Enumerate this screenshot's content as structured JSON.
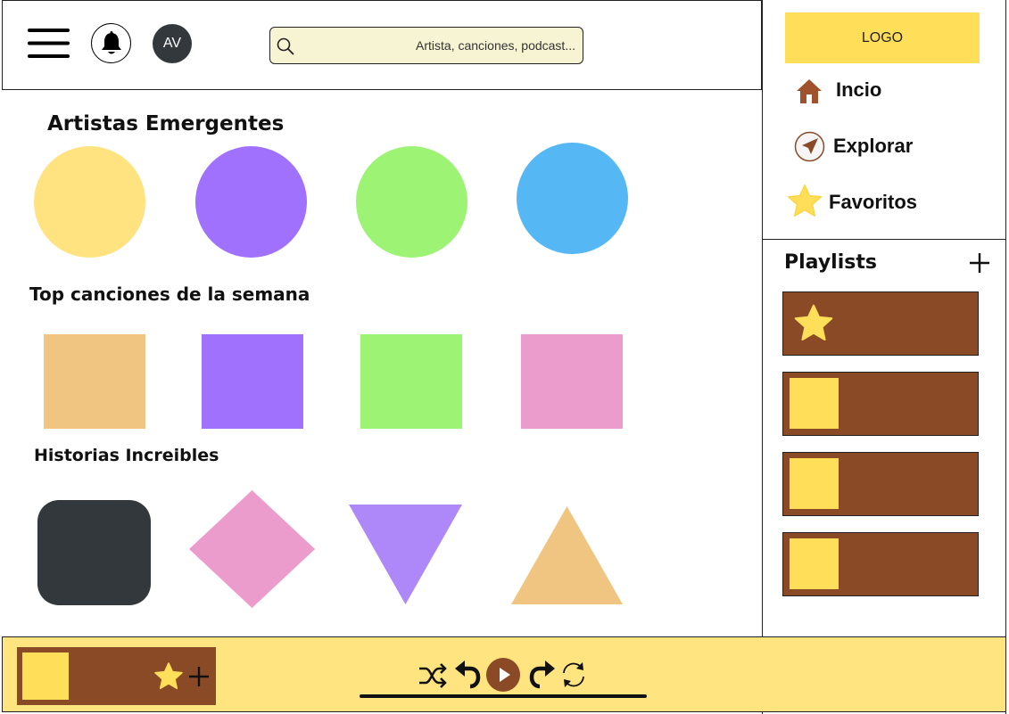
{
  "header": {
    "menu_icon": "hamburger-menu-icon",
    "bell_icon": "bell-icon",
    "avatar_initials": "AV",
    "search": {
      "icon": "search-icon",
      "placeholder": "Artista, canciones, podcast..."
    }
  },
  "main": {
    "sections": [
      {
        "title": "Artistas Emergentes",
        "items": [
          {
            "shape": "circle",
            "color": "#ffe380"
          },
          {
            "shape": "circle",
            "color": "#a071fc"
          },
          {
            "shape": "circle",
            "color": "#9cf374"
          },
          {
            "shape": "circle",
            "color": "#55b7f3"
          }
        ]
      },
      {
        "title": "Top canciones de la semana",
        "items": [
          {
            "shape": "square",
            "color": "#f0c581"
          },
          {
            "shape": "square",
            "color": "#a071fc"
          },
          {
            "shape": "square",
            "color": "#9cf374"
          },
          {
            "shape": "square",
            "color": "#ec9bcd"
          }
        ]
      },
      {
        "title": "Historias Increibles",
        "items": [
          {
            "shape": "rounded-square",
            "color": "#33383c"
          },
          {
            "shape": "diamond",
            "color": "#ec9bcd"
          },
          {
            "shape": "triangle-down",
            "color": "#ae88f8"
          },
          {
            "shape": "triangle-up",
            "color": "#f0c581"
          }
        ]
      }
    ]
  },
  "sidebar": {
    "logo": "LOGO",
    "nav": [
      {
        "label": "Incio",
        "icon": "home-icon"
      },
      {
        "label": "Explorar",
        "icon": "compass-icon"
      },
      {
        "label": "Favoritos",
        "icon": "star-icon"
      }
    ],
    "playlists_title": "Playlists",
    "add_icon": "plus-icon",
    "playlists": [
      {
        "thumb": "star-icon"
      },
      {
        "thumb": "cover"
      },
      {
        "thumb": "cover"
      },
      {
        "thumb": "cover"
      }
    ]
  },
  "player": {
    "favorite_icon": "star-icon",
    "add_icon": "plus-icon",
    "controls": [
      "shuffle-icon",
      "previous-icon",
      "play-icon",
      "next-icon",
      "repeat-icon"
    ]
  },
  "colors": {
    "accent_yellow": "#ffde59",
    "player_bg": "#ffe480",
    "brown": "#8b4a26",
    "dark": "#33383c",
    "search_bg": "#f6f4d2"
  }
}
